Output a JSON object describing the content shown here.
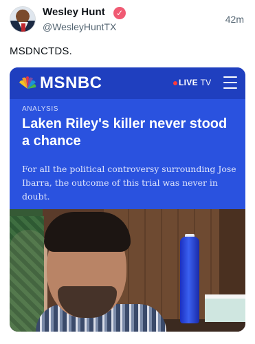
{
  "post": {
    "display_name": "Wesley Hunt",
    "handle": "@WesleyHuntTX",
    "timestamp": "42m",
    "text": "MSDNCTDS.",
    "verified_icon": "verified-badge-icon",
    "verified_color": "#f05a73"
  },
  "media": {
    "brand": "MSNBC",
    "live_label": "LIVE",
    "live_suffix": "TV",
    "section": "ANALYSIS",
    "headline": "Laken Riley's killer never stood a chance",
    "dek": "For all the political controversy surrounding Jose Ibarra, the outcome of this trial was never in doubt.",
    "brand_color": "#1f3fbf",
    "panel_color": "#2a52df",
    "icons": [
      "peacock-logo-icon",
      "live-dot-icon",
      "hamburger-menu-icon"
    ]
  }
}
